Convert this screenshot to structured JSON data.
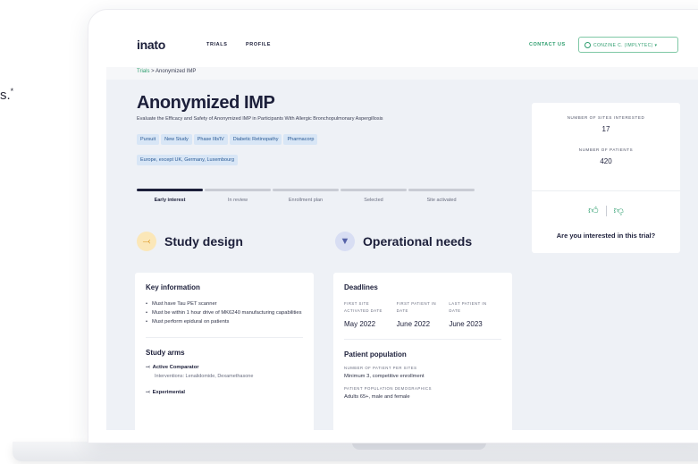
{
  "outside_text": "s.",
  "outside_sup": "*",
  "nav": {
    "logo": "inato",
    "links": [
      "TRIALS",
      "PROFILE"
    ],
    "contact": "CONTACT US",
    "user": "CONZINE C. (IMPLYTEC)"
  },
  "breadcrumb": {
    "root": "Trials",
    "sep": ">",
    "current": "Anonymized IMP"
  },
  "trial": {
    "title": "Anonymized IMP",
    "subtitle": "Evaluate the Efficacy and Safety of Anonymized IMP in Participants With Allergic Bronchopulmonary Aspergillosis",
    "tags": [
      "Pursuit",
      "New Study",
      "Phase IIb/IV",
      "Diabetic Retinopathy",
      "Pharmacorp",
      "Europe, except UK, Germany, Luxembourg"
    ]
  },
  "progress": {
    "steps": [
      "Early interest",
      "In review",
      "Enrollment plan",
      "Selected",
      "Site activated"
    ],
    "active_index": 0
  },
  "sections": {
    "study_design": "Study design",
    "operational_needs": "Operational needs"
  },
  "stats": {
    "sites_label": "NUMBER OF SITES INTERESTED",
    "sites_value": "17",
    "patients_label": "NUMBER OF PATIENTS",
    "patients_value": "420",
    "question": "Are you interested in this trial?",
    "thumbs_up": "thumbs-up-icon",
    "thumbs_down": "thumbs-down-icon"
  },
  "key_information": {
    "title": "Key information",
    "bullets": [
      "Must have Tau PET scanner",
      "Must be within 1 hour drive of MK6240 manufacturing capabilities",
      "Must perform epidural on patients"
    ]
  },
  "study_arms": {
    "title": "Study arms",
    "arms": [
      {
        "name": "Active Comparator",
        "sub": "Interventions: Lenalidomide, Dexamethasone"
      },
      {
        "name": "Experimental",
        "sub": ""
      }
    ]
  },
  "deadlines": {
    "title": "Deadlines",
    "items": [
      {
        "label": "FIRST SITE ACTIVATED DATE",
        "value": "May 2022"
      },
      {
        "label": "FIRST PATIENT IN DATE",
        "value": "June 2022"
      },
      {
        "label": "LAST PATIENT IN DATE",
        "value": "June 2023"
      }
    ]
  },
  "patient_population": {
    "title": "Patient population",
    "per_site_label": "NUMBER OF PATIENT PER SITES",
    "per_site_value": "Minimum 3, competitive enrollment",
    "demo_label": "PATIENT POPULATION DEMOGRAPHICS",
    "demo_value": "Adults 65+, male and female"
  },
  "colors": {
    "accent": "#2f9e6f",
    "navy": "#1c1f3a",
    "tag_bg": "#d8e6f6",
    "hero_bg": "#eef1f6"
  }
}
